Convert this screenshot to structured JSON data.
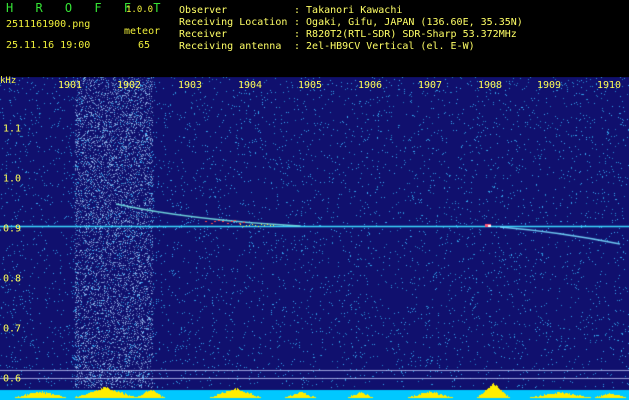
{
  "header": {
    "app_title": "H R O F F T",
    "app_version": "1.0.0",
    "filename": "2511161900.png",
    "timestamp": "25.11.16 19:00",
    "detection_label": "meteor",
    "detection_count": "65",
    "info": [
      {
        "label": "Observer",
        "value": ": Takanori Kawachi"
      },
      {
        "label": "Receiving Location",
        "value": ": Ogaki, Gifu, JAPAN (136.60E, 35.35N)"
      },
      {
        "label": "Receiver",
        "value": ": R820T2(RTL-SDR) SDR-Sharp 53.372MHz"
      },
      {
        "label": "Receiving antenna",
        "value": ": 2el-HB9CV Vertical (el. E-W)"
      }
    ]
  },
  "axes": {
    "y_unit": "kHz",
    "x_ticks": [
      "1901",
      "1902",
      "1903",
      "1904",
      "1905",
      "1906",
      "1907",
      "1908",
      "1909",
      "1910"
    ],
    "y_ticks": [
      "1.1",
      "1.0",
      "0.9",
      "0.8",
      "0.7",
      "0.6"
    ]
  },
  "colors": {
    "background": "#000000",
    "plot_background": "#10106e",
    "carrier": "#3ad8ff",
    "text_green": "#35e335",
    "text_yellow": "#f0f03a",
    "strip": "#00c8ff",
    "strip_peak": "#ffee00"
  }
}
